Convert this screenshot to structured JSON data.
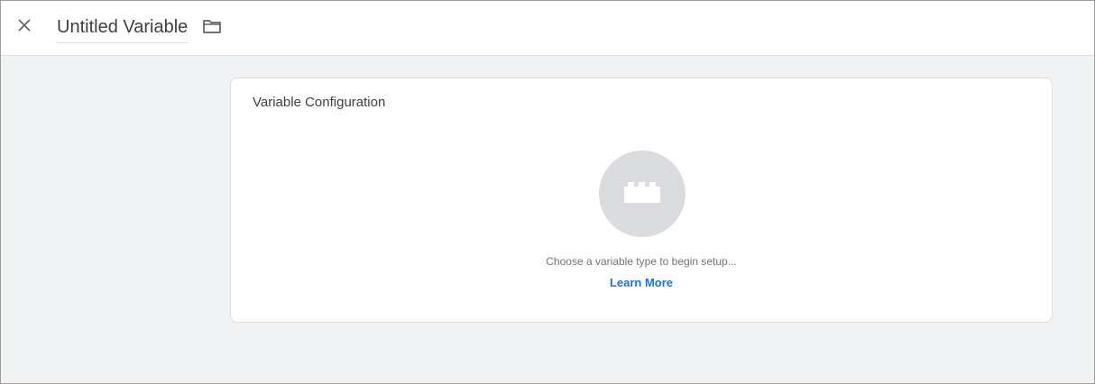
{
  "header": {
    "close_icon": "close-icon",
    "title": "Untitled Variable",
    "folder_icon": "folder-icon"
  },
  "card": {
    "title": "Variable Configuration",
    "type_icon": "lego-brick-icon",
    "hint": "Choose a variable type to begin setup...",
    "learn_more": "Learn More"
  },
  "colors": {
    "background": "#f1f2f4",
    "circle": "#dadce0",
    "link": "#1a73e8"
  }
}
